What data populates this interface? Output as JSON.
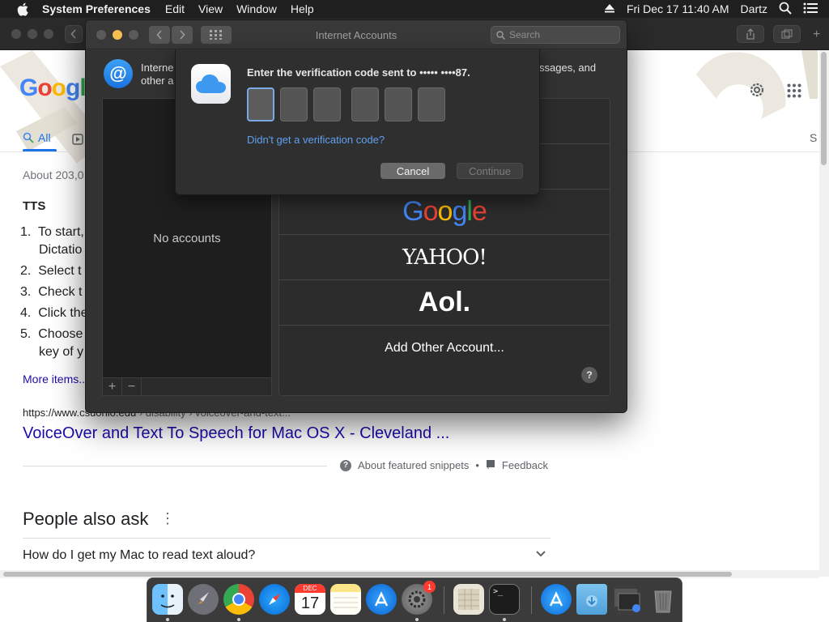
{
  "menubar": {
    "app_name": "System Preferences",
    "menus": [
      "Edit",
      "View",
      "Window",
      "Help"
    ],
    "clock": "Fri Dec 17  11:40 AM",
    "user": "Dartz"
  },
  "google": {
    "tab_all": "All",
    "stats": "About 203,0",
    "heading": "TTS",
    "list_items": [
      {
        "num": "1.",
        "text": "To start,",
        "cont": "Dictatio"
      },
      {
        "num": "2.",
        "text": "Select t"
      },
      {
        "num": "3.",
        "text": "Check t"
      },
      {
        "num": "4.",
        "text": "Click the"
      },
      {
        "num": "5.",
        "text": "Choose",
        "cont": "key of y"
      }
    ],
    "more_items": "More items...",
    "result_url_domain": "https://www.csuohio.edu",
    "result_url_path": " › disability › voiceover-and-text...",
    "result_title": "VoiceOver and Text To Speech for Mac OS X - Cleveland ...",
    "about_snippets": "About featured snippets",
    "bullet": "•",
    "feedback": "Feedback",
    "paa_title": "People also ask",
    "paa_question": "How do I get my Mac to read text aloud?",
    "right_cut": "S"
  },
  "window": {
    "title": "Internet Accounts",
    "search_placeholder": "Search",
    "desc_left_1": "Interne",
    "desc_left_2": "other a",
    "desc_right": "ssages, and",
    "no_accounts": "No accounts",
    "providers": {
      "yahoo": "YAHOO!",
      "aol": "Aol.",
      "other": "Add Other Account..."
    },
    "help": "?",
    "plus": "+",
    "minus": "−"
  },
  "sheet": {
    "title": "Enter the verification code sent to ••••• ••••87.",
    "didnt_get": "Didn't get a verification code?",
    "cancel": "Cancel",
    "continue": "Continue"
  },
  "dock": {
    "calendar_month": "DEC",
    "calendar_day": "17",
    "badge": "1",
    "terminal_prompt": ">_"
  },
  "colors": {
    "accent": "#1a73e8",
    "link": "#1a0dab",
    "sheet_link": "#5fa0f0"
  }
}
